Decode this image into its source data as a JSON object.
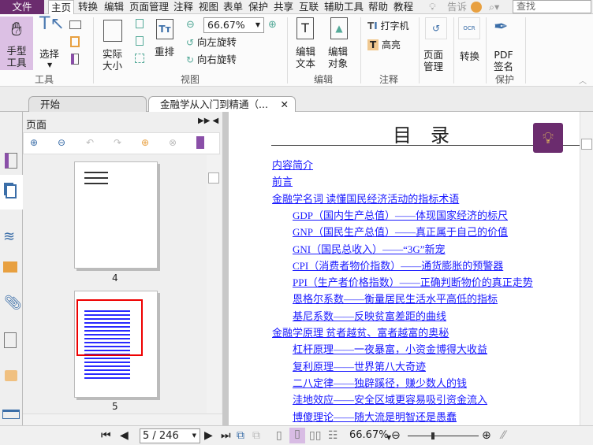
{
  "menu": {
    "items": [
      "文件",
      "主页",
      "转换",
      "编辑",
      "页面管理",
      "注释",
      "视图",
      "表单",
      "保护",
      "共享",
      "互联",
      "辅助工具",
      "帮助",
      "教程"
    ],
    "tell": "告诉",
    "search_placeholder": "查找"
  },
  "ribbon": {
    "hand": "手型\n工具",
    "select": "选择",
    "tools_group": "工具",
    "actual_size": "实际\n大小",
    "reflow": "重排",
    "zoom_value": "66.67%",
    "rotate_left": "向左旋转",
    "rotate_right": "向右旋转",
    "view_group": "视图",
    "edit_text": "编辑\n文本",
    "edit_object": "编辑\n对象",
    "edit_group": "编辑",
    "typewriter": "打字机",
    "highlight": "高亮",
    "comment_group": "注释",
    "page_manage": "页面\n管理",
    "convert": "转换",
    "pdf_sign": "PDF\n签名",
    "protect_group": "保护"
  },
  "tabs": [
    {
      "label": "开始"
    },
    {
      "label": "金融学从入门到精通（..."
    }
  ],
  "panel": {
    "title": "页面",
    "thumbs": [
      {
        "page": "4"
      },
      {
        "page": "5"
      }
    ]
  },
  "document": {
    "title": "目　录",
    "toc": [
      {
        "t": "内容简介",
        "l": 1
      },
      {
        "t": "前言",
        "l": 1
      },
      {
        "t": "金融学名词 读懂国民经济活动的指标术语",
        "l": 1
      },
      {
        "t": "GDP（国内生产总值）——体现国家经济的标尺",
        "l": 2
      },
      {
        "t": "GNP（国民生产总值）——真正属于自己的价值",
        "l": 2
      },
      {
        "t": "GNI（国民总收入）——“3G”新宠",
        "l": 2
      },
      {
        "t": "CPI（消费者物价指数）——通货膨胀的预警器",
        "l": 2
      },
      {
        "t": "PPI（生产者价格指数）——正确判断物价的真正走势",
        "l": 2
      },
      {
        "t": "恩格尔系数——衡量居民生活水平高低的指标",
        "l": 2
      },
      {
        "t": "基尼系数——反映贫富差距的曲线",
        "l": 2
      },
      {
        "t": "金融学原理 贫者越贫、富者越富的奥秘",
        "l": 1
      },
      {
        "t": "杠杆原理——一夜暴富，小资金博得大收益",
        "l": 2
      },
      {
        "t": "复利原理——世界第八大奇迹",
        "l": 2
      },
      {
        "t": "二八定律——独辟蹊径，赚少数人的钱",
        "l": 2
      },
      {
        "t": "洼地效应——安全区域更容易吸引资金流入",
        "l": 2
      },
      {
        "t": "博傻理论——随大流是明智还是愚蠢",
        "l": 2
      }
    ]
  },
  "status": {
    "page": "5 / 246",
    "zoom": "66.67%"
  },
  "colors": {
    "brand": "#6b2c6e",
    "link": "#1a1aff"
  }
}
